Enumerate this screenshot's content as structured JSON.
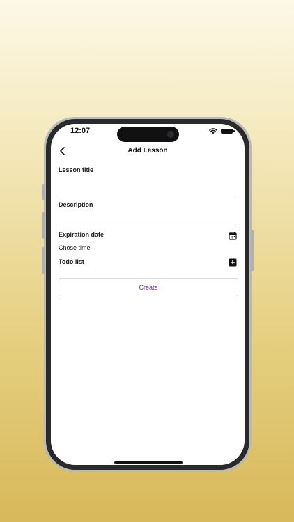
{
  "status_bar": {
    "time": "12:07"
  },
  "header": {
    "title": "Add Lesson"
  },
  "form": {
    "lesson_title_label": "Lesson title",
    "lesson_title_value": "",
    "description_label": "Description",
    "description_value": "",
    "expiration_date_label": "Expiration date",
    "chose_time_label": "Chose time",
    "todo_list_label": "Todo list"
  },
  "actions": {
    "create_label": "Create"
  },
  "colors": {
    "accent": "#7b2fb5",
    "background_top": "#fdf8e6",
    "background_bottom": "#d8b95b"
  },
  "icons": {
    "back": "chevron-left-icon",
    "calendar": "calendar-icon",
    "add": "plus-square-icon",
    "wifi": "wifi-icon",
    "battery": "battery-icon"
  }
}
